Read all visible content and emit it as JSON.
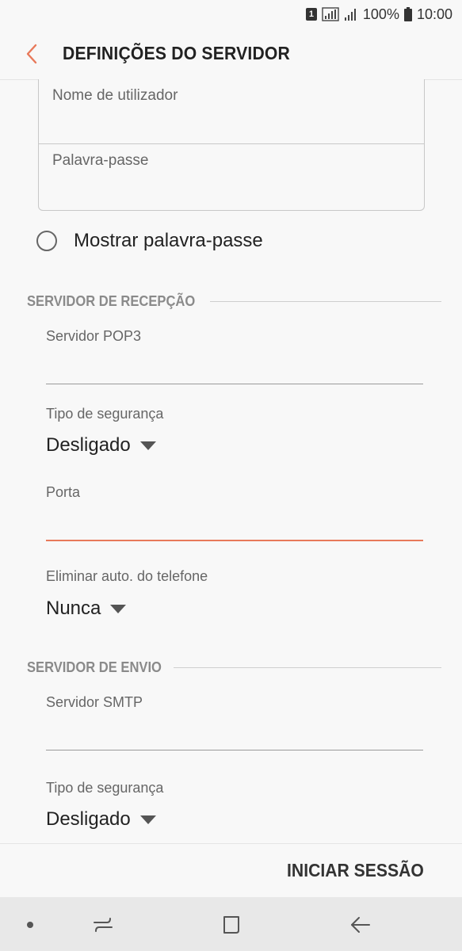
{
  "status_bar": {
    "sim": "1",
    "battery": "100%",
    "time": "10:00"
  },
  "app_bar": {
    "title": "DEFINIÇÕES DO SERVIDOR",
    "accent_color": "#e8795a"
  },
  "credentials": {
    "username_placeholder": "Nome de utilizador",
    "username_value": "",
    "password_placeholder": "Palavra-passe",
    "password_value": "",
    "show_password_label": "Mostrar palavra-passe",
    "show_password_checked": false
  },
  "incoming": {
    "section_title": "SERVIDOR DE RECEPÇÃO",
    "server_label": "Servidor POP3",
    "server_value": "",
    "security_label": "Tipo de segurança",
    "security_value": "Desligado",
    "port_label": "Porta",
    "port_value": "",
    "delete_label": "Eliminar auto. do telefone",
    "delete_value": "Nunca"
  },
  "outgoing": {
    "section_title": "SERVIDOR DE ENVIO",
    "server_label": "Servidor SMTP",
    "server_value": "",
    "security_label": "Tipo de segurança",
    "security_value": "Desligado"
  },
  "actions": {
    "sign_in_label": "INICIAR SESSÃO"
  },
  "nav_bar": {
    "icons": [
      "dot-icon",
      "recent-apps-icon",
      "home-icon",
      "back-arrow-icon"
    ]
  }
}
